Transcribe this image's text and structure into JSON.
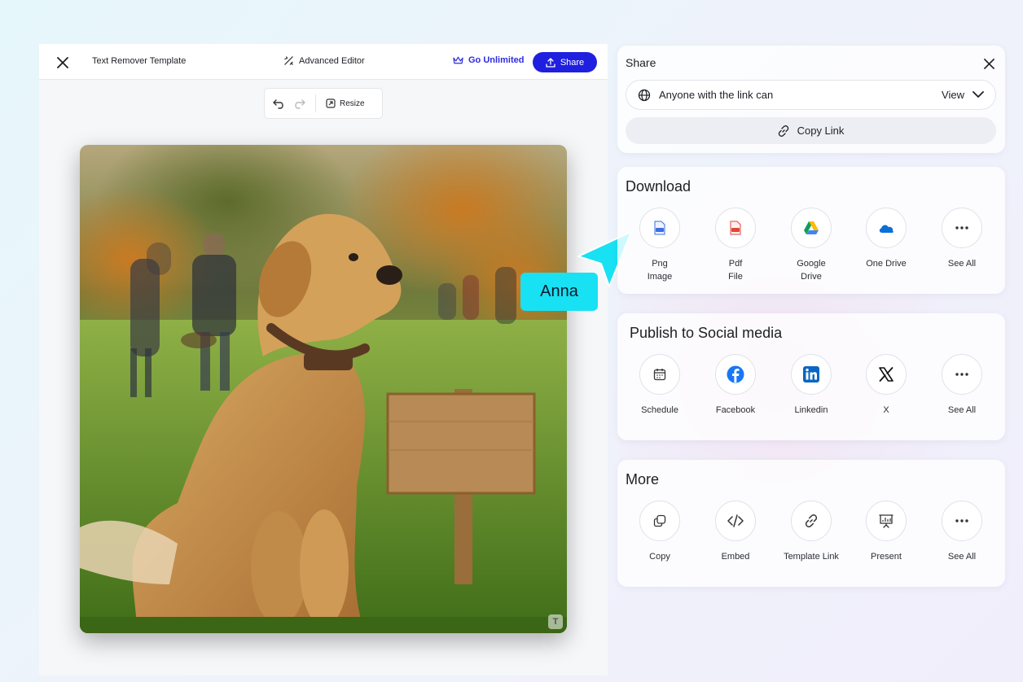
{
  "topbar": {
    "doc_title": "Text Remover Template",
    "advanced_editor": "Advanced Editor",
    "go_unlimited": "Go Unlimited",
    "share_label": "Share"
  },
  "toolbar": {
    "resize_label": "Resize"
  },
  "cursor": {
    "user_name": "Anna",
    "color": "#18e1f3"
  },
  "share_panel": {
    "title": "Share",
    "link_access": "Anyone with the link can",
    "permission": "View",
    "copy_link": "Copy Link"
  },
  "download": {
    "title": "Download",
    "items": [
      {
        "label": "Png\nImage",
        "icon": "png-file-icon"
      },
      {
        "label": "Pdf\nFile",
        "icon": "pdf-file-icon"
      },
      {
        "label": "Google\nDrive",
        "icon": "google-drive-icon"
      },
      {
        "label": "One Drive",
        "icon": "onedrive-icon"
      },
      {
        "label": "See All",
        "icon": "more-dots-icon"
      }
    ]
  },
  "social": {
    "title": "Publish to Social media",
    "items": [
      {
        "label": "Schedule",
        "icon": "calendar-icon"
      },
      {
        "label": "Facebook",
        "icon": "facebook-icon"
      },
      {
        "label": "Linkedin",
        "icon": "linkedin-icon"
      },
      {
        "label": "X",
        "icon": "x-logo-icon"
      },
      {
        "label": "See All",
        "icon": "more-dots-icon"
      }
    ]
  },
  "more": {
    "title": "More",
    "items": [
      {
        "label": "Copy",
        "icon": "copy-icon"
      },
      {
        "label": "Embed",
        "icon": "code-icon"
      },
      {
        "label": "Template Link",
        "icon": "link-icon"
      },
      {
        "label": "Present",
        "icon": "presentation-icon"
      },
      {
        "label": "See All",
        "icon": "more-dots-icon"
      }
    ]
  },
  "colors": {
    "primary": "#1f1fe0",
    "go_unlimited": "#2d2be0",
    "facebook": "#1877f2",
    "linkedin": "#0a66c2"
  }
}
